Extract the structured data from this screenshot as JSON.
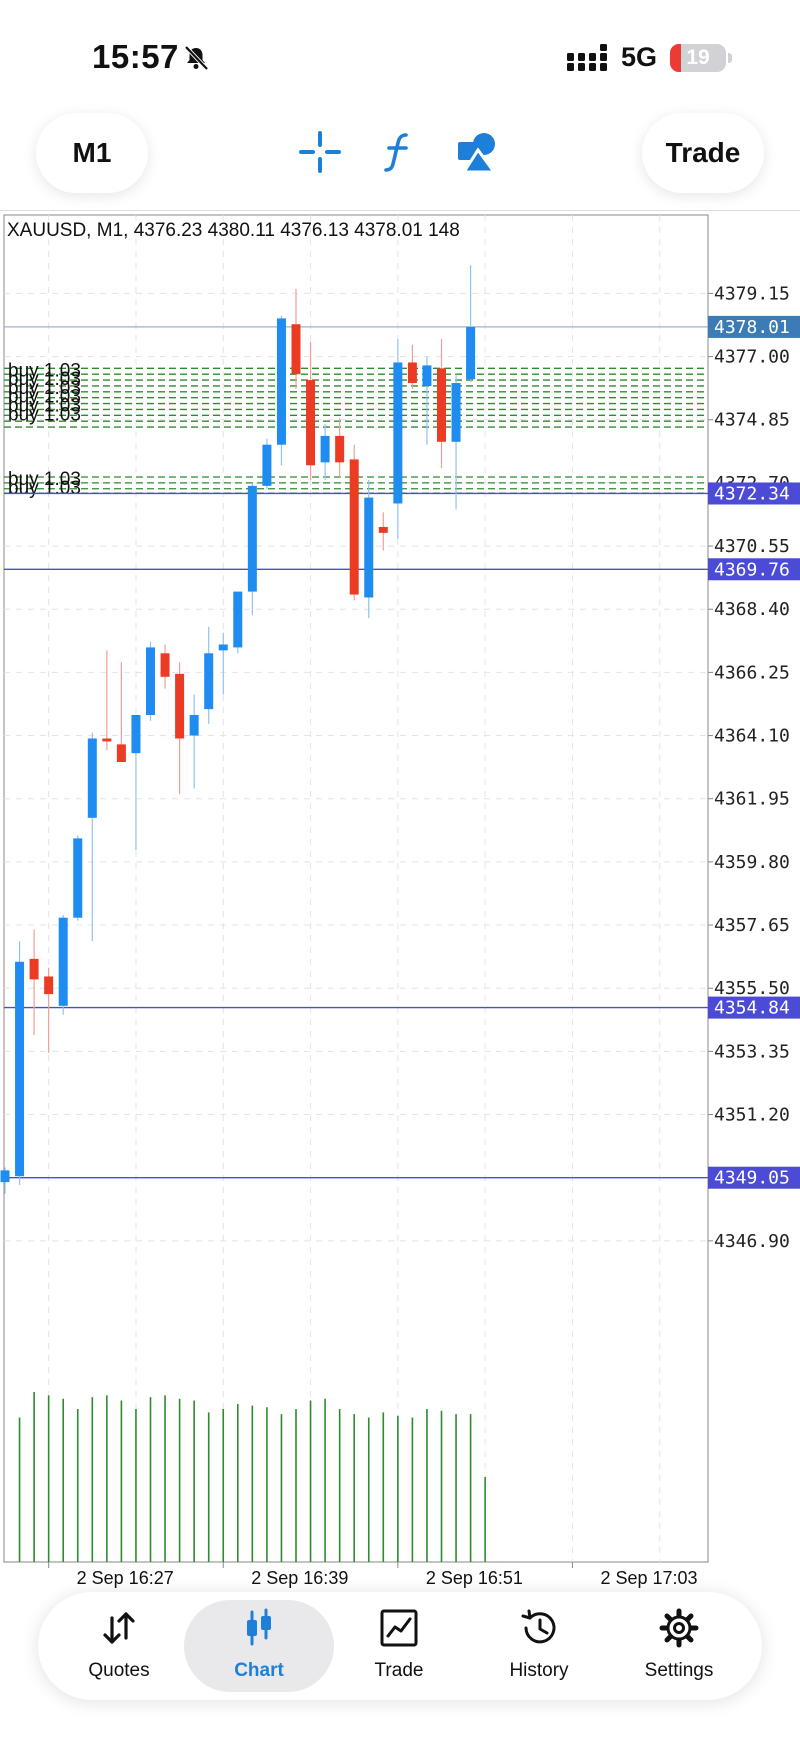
{
  "status_bar": {
    "time": "15:57",
    "network": "5G",
    "battery": "19",
    "battery_level": 0.19
  },
  "toolbar": {
    "timeframe": "M1",
    "trade_label": "Trade",
    "tools": [
      "crosshair-icon",
      "indicators-icon",
      "objects-icon"
    ],
    "accent_color": "#1e7fd8"
  },
  "chart": {
    "header": "XAUUSD, M1, 4376.23 4380.11 4376.13 4378.01 148",
    "order_label": "buy 1.03",
    "colors": {
      "bull": "#1e8cf0",
      "bear": "#ec3b24",
      "volume": "#2e8b2e",
      "order_lines": "#2e8b2e",
      "level_lines": "#4b4bd6",
      "current_price_tag": "#3c7cb6"
    }
  },
  "chart_data": {
    "type": "candlestick",
    "symbol": "XAUUSD",
    "timeframe": "M1",
    "ylim": [
      4345.5,
      4380.9
    ],
    "y_ticks": [
      "4379.15",
      "4377.00",
      "4374.85",
      "4372.70",
      "4370.55",
      "4368.40",
      "4366.25",
      "4364.10",
      "4361.95",
      "4359.80",
      "4357.65",
      "4355.50",
      "4353.35",
      "4351.20",
      "4346.90"
    ],
    "x_ticks": [
      "2 Sep 16:27",
      "2 Sep 16:39",
      "2 Sep 16:51",
      "2 Sep 17:03"
    ],
    "current_price": "4378.01",
    "price_levels": [
      "4372.34",
      "4369.76",
      "4354.84",
      "4349.05"
    ],
    "order_lines": [
      4376.6,
      4376.4,
      4376.2,
      4376.0,
      4375.8,
      4375.6,
      4375.4,
      4375.2,
      4375.0,
      4374.8,
      4374.6,
      4372.9,
      4372.7,
      4372.5,
      4372.35
    ],
    "candles": [
      {
        "o": 4348.9,
        "h": 4349.4,
        "l": 4348.5,
        "c": 4349.3
      },
      {
        "o": 4349.1,
        "h": 4357.1,
        "l": 4348.8,
        "c": 4356.4
      },
      {
        "o": 4356.5,
        "h": 4357.5,
        "l": 4353.9,
        "c": 4355.8
      },
      {
        "o": 4355.9,
        "h": 4356.2,
        "l": 4353.3,
        "c": 4355.3
      },
      {
        "o": 4354.9,
        "h": 4358.0,
        "l": 4354.6,
        "c": 4357.9
      },
      {
        "o": 4357.9,
        "h": 4360.7,
        "l": 4357.8,
        "c": 4360.6
      },
      {
        "o": 4361.3,
        "h": 4364.2,
        "l": 4357.1,
        "c": 4364.0
      },
      {
        "o": 4364.0,
        "h": 4367.0,
        "l": 4363.6,
        "c": 4363.9
      },
      {
        "o": 4363.8,
        "h": 4366.6,
        "l": 4363.3,
        "c": 4363.2
      },
      {
        "o": 4363.5,
        "h": 4364.5,
        "l": 4360.2,
        "c": 4364.8
      },
      {
        "o": 4364.8,
        "h": 4367.3,
        "l": 4364.6,
        "c": 4367.1
      },
      {
        "o": 4366.9,
        "h": 4367.2,
        "l": 4365.7,
        "c": 4366.1
      },
      {
        "o": 4366.2,
        "h": 4366.6,
        "l": 4362.1,
        "c": 4364.0
      },
      {
        "o": 4364.1,
        "h": 4365.5,
        "l": 4362.3,
        "c": 4364.8
      },
      {
        "o": 4365.0,
        "h": 4367.8,
        "l": 4364.5,
        "c": 4366.9
      },
      {
        "o": 4367.0,
        "h": 4367.6,
        "l": 4365.5,
        "c": 4367.2
      },
      {
        "o": 4367.1,
        "h": 4369.0,
        "l": 4366.9,
        "c": 4369.0
      },
      {
        "o": 4369.0,
        "h": 4372.7,
        "l": 4368.2,
        "c": 4372.6
      },
      {
        "o": 4372.6,
        "h": 4374.2,
        "l": 4372.5,
        "c": 4374.0
      },
      {
        "o": 4374.0,
        "h": 4378.4,
        "l": 4373.3,
        "c": 4378.3
      },
      {
        "o": 4378.1,
        "h": 4379.3,
        "l": 4375.9,
        "c": 4376.4
      },
      {
        "o": 4376.2,
        "h": 4377.5,
        "l": 4372.8,
        "c": 4373.3
      },
      {
        "o": 4373.4,
        "h": 4374.7,
        "l": 4372.8,
        "c": 4374.3
      },
      {
        "o": 4374.3,
        "h": 4374.9,
        "l": 4372.9,
        "c": 4373.4
      },
      {
        "o": 4373.5,
        "h": 4374.0,
        "l": 4368.7,
        "c": 4368.9
      },
      {
        "o": 4368.8,
        "h": 4372.8,
        "l": 4368.1,
        "c": 4372.2
      },
      {
        "o": 4371.2,
        "h": 4371.7,
        "l": 4370.4,
        "c": 4371.0
      },
      {
        "o": 4372.0,
        "h": 4377.6,
        "l": 4370.8,
        "c": 4376.8
      },
      {
        "o": 4376.8,
        "h": 4377.4,
        "l": 4375.9,
        "c": 4376.1
      },
      {
        "o": 4376.0,
        "h": 4377.0,
        "l": 4374.0,
        "c": 4376.7
      },
      {
        "o": 4376.6,
        "h": 4377.6,
        "l": 4373.2,
        "c": 4374.1
      },
      {
        "o": 4374.1,
        "h": 4376.4,
        "l": 4371.8,
        "c": 4376.1
      },
      {
        "o": 4376.23,
        "h": 4380.11,
        "l": 4376.13,
        "c": 4378.01
      }
    ],
    "volumes": [
      85,
      100,
      98,
      96,
      90,
      97,
      98,
      95,
      90,
      97,
      98,
      96,
      95,
      88,
      90,
      93,
      92,
      91,
      87,
      90,
      95,
      96,
      90,
      87,
      85,
      88,
      86,
      85,
      90,
      89,
      87,
      87,
      50
    ]
  },
  "bottom_nav": {
    "items": [
      {
        "label": "Quotes",
        "icon": "quotes-icon"
      },
      {
        "label": "Chart",
        "icon": "chart-icon",
        "active": true
      },
      {
        "label": "Trade",
        "icon": "trade-icon"
      },
      {
        "label": "History",
        "icon": "history-icon"
      },
      {
        "label": "Settings",
        "icon": "settings-icon"
      }
    ]
  }
}
